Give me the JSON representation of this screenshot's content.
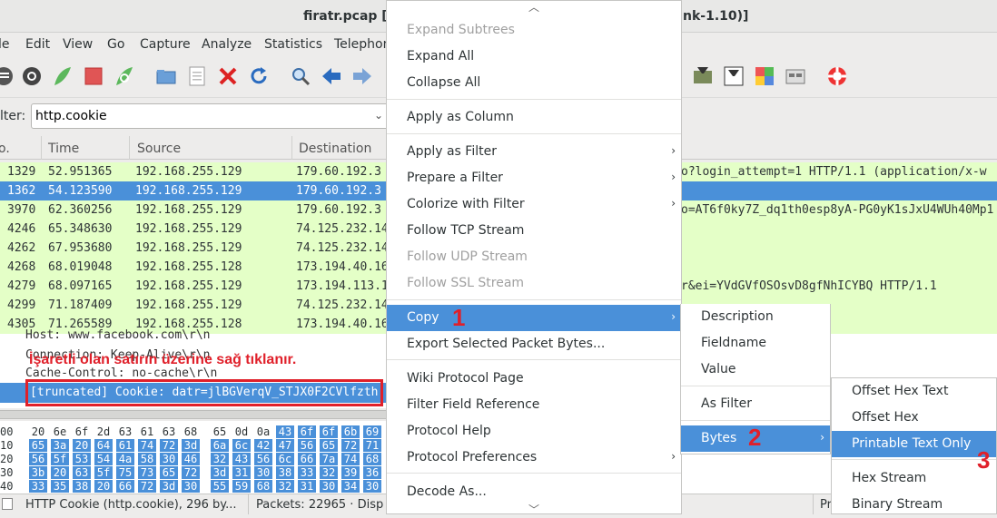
{
  "window": {
    "title_left": "firatr.pcap  [",
    "title_right": "nk-1.10)]"
  },
  "menubar": [
    "le",
    "Edit",
    "View",
    "Go",
    "Capture",
    "Analyze",
    "Statistics",
    "Telephon"
  ],
  "toolbar": {
    "icons": [
      "interfaces-icon",
      "options-icon",
      "start-capture-icon",
      "stop-capture-icon",
      "restart-capture-icon",
      "open-file-icon",
      "file-set-icon",
      "close-file-icon",
      "reload-icon",
      "find-icon",
      "back-icon",
      "forward-icon"
    ],
    "right_icons": [
      "capture-filters-icon",
      "display-filters-icon",
      "coloring-rules-icon",
      "preferences-icon",
      "help-icon"
    ]
  },
  "filter": {
    "label": "lter:",
    "value": "http.cookie"
  },
  "packet_list": {
    "headers": [
      "o.",
      "Time",
      "Source",
      "Destination"
    ],
    "rows": [
      {
        "no": "1329",
        "time": "52.951365",
        "src": "192.168.255.129",
        "dst": "179.60.192.3",
        "info": "o?login_attempt=1 HTTP/1.1  (application/x-w"
      },
      {
        "no": "1362",
        "time": "54.123590",
        "src": "192.168.255.129",
        "dst": "179.60.192.3",
        "info": ""
      },
      {
        "no": "3970",
        "time": "62.360256",
        "src": "192.168.255.129",
        "dst": "179.60.192.3",
        "info": "o=AT6f0ky7Z_dq1th0esp8yA-PG0yK1sJxU4WUh40Mp1"
      },
      {
        "no": "4246",
        "time": "65.348630",
        "src": "192.168.255.129",
        "dst": "74.125.232.14",
        "info": ""
      },
      {
        "no": "4262",
        "time": "67.953680",
        "src": "192.168.255.129",
        "dst": "74.125.232.14",
        "info": ""
      },
      {
        "no": "4268",
        "time": "68.019048",
        "src": "192.168.255.128",
        "dst": "173.194.40.16",
        "info": ""
      },
      {
        "no": "4279",
        "time": "68.097165",
        "src": "192.168.255.129",
        "dst": "173.194.113.1",
        "info": "r&ei=YVdGVfOSOsvD8gfNhICYBQ HTTP/1.1"
      },
      {
        "no": "4299",
        "time": "71.187409",
        "src": "192.168.255.129",
        "dst": "74.125.232.14",
        "info": ""
      },
      {
        "no": "4305",
        "time": "71.265589",
        "src": "192.168.255.128",
        "dst": "173.194.40.16",
        "info": ""
      }
    ]
  },
  "details": {
    "line1": "Host: www.facebook.com\\r\\n",
    "line2": "Connection: Keep-Alive\\r\\n",
    "line3": "Cache-Control: no-cache\\r\\n",
    "selected": "[truncated] Cookie: datr=jlBGVerqV_STJX0F2CVlfzth",
    "annotation": "İşaretli olan satırın üzerine sağ tıklanır."
  },
  "hex": [
    {
      "off": "00",
      "bytes": [
        "20",
        "6e",
        "6f",
        "2d",
        "63",
        "61",
        "63",
        "68",
        "65",
        "0d",
        "0a",
        "43",
        "6f",
        "6f",
        "6b",
        "69"
      ],
      "sel_from": 11
    },
    {
      "off": "10",
      "bytes": [
        "65",
        "3a",
        "20",
        "64",
        "61",
        "74",
        "72",
        "3d",
        "6a",
        "6c",
        "42",
        "47",
        "56",
        "65",
        "72",
        "71"
      ],
      "sel_from": 0
    },
    {
      "off": "20",
      "bytes": [
        "56",
        "5f",
        "53",
        "54",
        "4a",
        "58",
        "30",
        "46",
        "32",
        "43",
        "56",
        "6c",
        "66",
        "7a",
        "74",
        "68"
      ],
      "sel_from": 0
    },
    {
      "off": "30",
      "bytes": [
        "3b",
        "20",
        "63",
        "5f",
        "75",
        "73",
        "65",
        "72",
        "3d",
        "31",
        "30",
        "38",
        "33",
        "32",
        "39",
        "36"
      ],
      "sel_from": 0
    },
    {
      "off": "40",
      "bytes": [
        "33",
        "35",
        "38",
        "20",
        "66",
        "72",
        "3d",
        "30",
        "55",
        "59",
        "68",
        "32",
        "31",
        "30",
        "34",
        "30"
      ],
      "sel_from": 0
    }
  ],
  "status": {
    "field": "HTTP Cookie (http.cookie), 296 by...",
    "packets": "Packets: 22965 · Disp",
    "profile": "Pr"
  },
  "context_menu": {
    "items": [
      {
        "label": "Expand Subtrees",
        "disabled": true
      },
      {
        "label": "Expand All"
      },
      {
        "label": "Collapse All"
      },
      {
        "label": "Apply as Column"
      },
      {
        "label": "Apply as Filter",
        "submenu": true
      },
      {
        "label": "Prepare a Filter",
        "submenu": true
      },
      {
        "label": "Colorize with Filter",
        "submenu": true
      },
      {
        "label": "Follow TCP Stream"
      },
      {
        "label": "Follow UDP Stream",
        "disabled": true
      },
      {
        "label": "Follow SSL Stream",
        "disabled": true
      },
      {
        "label": "Copy",
        "submenu": true,
        "highlighted": true
      },
      {
        "label": "Export Selected Packet Bytes..."
      },
      {
        "label": "Wiki Protocol Page"
      },
      {
        "label": "Filter Field Reference"
      },
      {
        "label": "Protocol Help"
      },
      {
        "label": "Protocol Preferences",
        "submenu": true
      },
      {
        "label": "Decode As..."
      }
    ],
    "scroll_up": "︿",
    "scroll_down": "﹀"
  },
  "copy_menu": {
    "items": [
      {
        "label": "Description"
      },
      {
        "label": "Fieldname"
      },
      {
        "label": "Value"
      },
      {
        "label": "As Filter"
      },
      {
        "label": "Bytes",
        "submenu": true,
        "highlighted": true
      }
    ]
  },
  "bytes_menu": {
    "items": [
      {
        "label": "Offset Hex Text"
      },
      {
        "label": "Offset Hex"
      },
      {
        "label": "Printable Text Only",
        "highlighted": true
      },
      {
        "label": "Hex Stream"
      },
      {
        "label": "Binary Stream"
      }
    ]
  },
  "step_numbers": [
    "1",
    "2",
    "3"
  ],
  "colors": {
    "selection": "#4a90d9",
    "row_http": "#e4ffc7",
    "annotation_red": "#e0202a"
  }
}
